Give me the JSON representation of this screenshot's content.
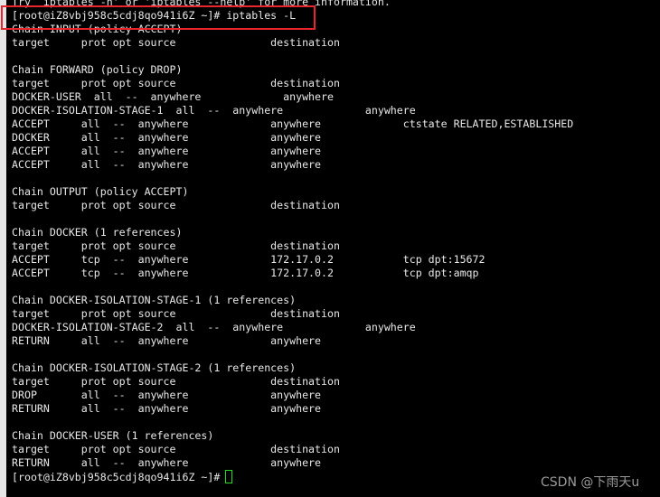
{
  "colors": {
    "background": "#000000",
    "text": "#e8e8e8",
    "highlight_box": "#e8262e",
    "cursor": "#1ee01e",
    "watermark": "#9a9a9a"
  },
  "terminal": {
    "lines": [
      "Try `iptables -h' or 'iptables --help' for more information.",
      "[root@iZ8vbj958c5cdj8qo941i6Z ~]# iptables -L",
      "Chain INPUT (policy ACCEPT)",
      "target     prot opt source               destination",
      "",
      "Chain FORWARD (policy DROP)",
      "target     prot opt source               destination",
      "DOCKER-USER  all  --  anywhere             anywhere",
      "DOCKER-ISOLATION-STAGE-1  all  --  anywhere             anywhere",
      "ACCEPT     all  --  anywhere             anywhere             ctstate RELATED,ESTABLISHED",
      "DOCKER     all  --  anywhere             anywhere",
      "ACCEPT     all  --  anywhere             anywhere",
      "ACCEPT     all  --  anywhere             anywhere",
      "",
      "Chain OUTPUT (policy ACCEPT)",
      "target     prot opt source               destination",
      "",
      "Chain DOCKER (1 references)",
      "target     prot opt source               destination",
      "ACCEPT     tcp  --  anywhere             172.17.0.2           tcp dpt:15672",
      "ACCEPT     tcp  --  anywhere             172.17.0.2           tcp dpt:amqp",
      "",
      "Chain DOCKER-ISOLATION-STAGE-1 (1 references)",
      "target     prot opt source               destination",
      "DOCKER-ISOLATION-STAGE-2  all  --  anywhere             anywhere",
      "RETURN     all  --  anywhere             anywhere",
      "",
      "Chain DOCKER-ISOLATION-STAGE-2 (1 references)",
      "target     prot opt source               destination",
      "DROP       all  --  anywhere             anywhere",
      "RETURN     all  --  anywhere             anywhere",
      "",
      "Chain DOCKER-USER (1 references)",
      "target     prot opt source               destination",
      "RETURN     all  --  anywhere             anywhere"
    ],
    "prompt": "[root@iZ8vbj958c5cdj8qo941i6Z ~]#"
  },
  "watermark": "CSDN @下雨天u"
}
